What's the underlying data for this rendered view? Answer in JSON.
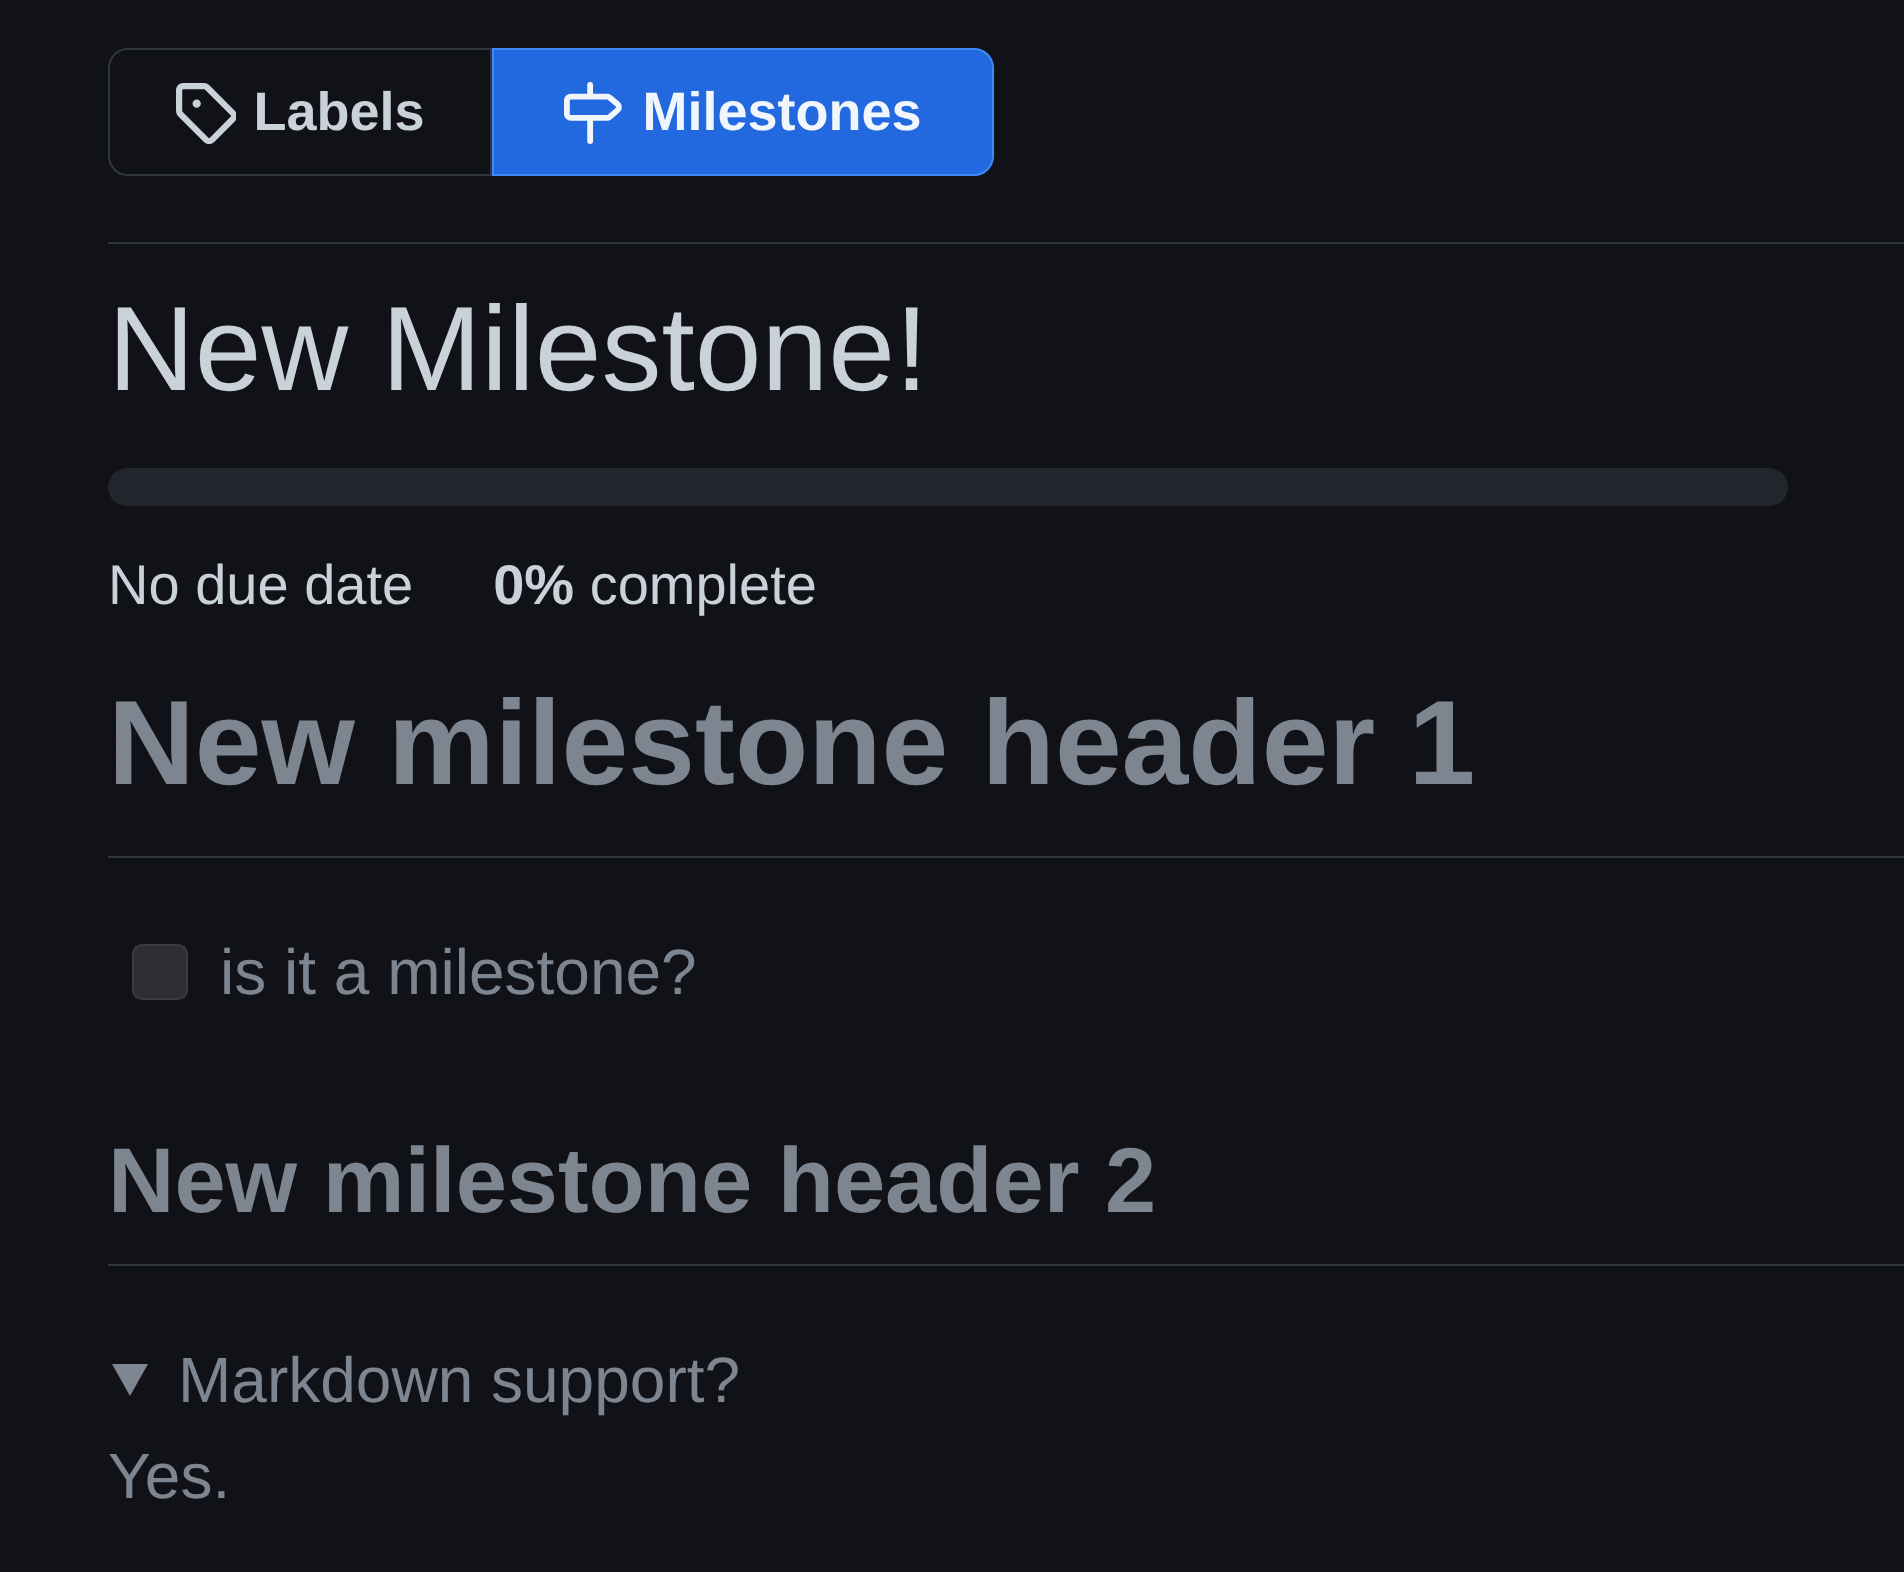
{
  "tabs": [
    {
      "label": "Labels",
      "selected": false
    },
    {
      "label": "Milestones",
      "selected": true
    }
  ],
  "milestone": {
    "title": "New Milestone!",
    "progress": {
      "level": 0
    },
    "due_date": "No due date",
    "completion": "**0%** complete"
  },
  "description": [
    {
      "kind": "heading1",
      "text": "New milestone header 1"
    },
    {
      "kind": "task",
      "text": "is it a milestone?",
      "checked": false
    },
    {
      "kind": "heading2",
      "text": "New milestone header 2"
    },
    {
      "kind": "details",
      "summary": "Markdown support?",
      "expanded": true,
      "body": "Yes."
    }
  ]
}
